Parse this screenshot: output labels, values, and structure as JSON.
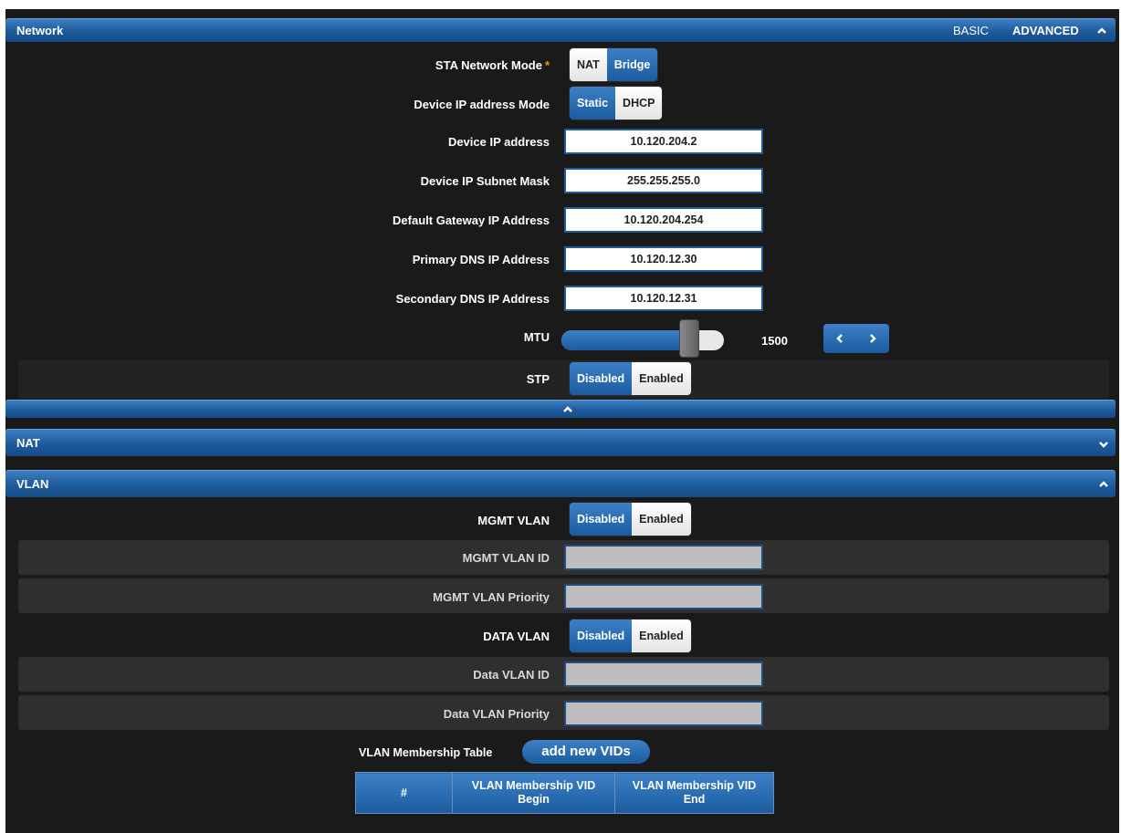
{
  "network": {
    "title": "Network",
    "mode_basic": "BASIC",
    "mode_advanced": "ADVANCED",
    "sta_mode": {
      "label": "STA Network Mode",
      "required": "*",
      "options": [
        "NAT",
        "Bridge"
      ],
      "selected": "Bridge"
    },
    "ip_mode": {
      "label": "Device IP address Mode",
      "options": [
        "Static",
        "DHCP"
      ],
      "selected": "Static"
    },
    "ip_address": {
      "label": "Device IP address",
      "value": "10.120.204.2"
    },
    "subnet": {
      "label": "Device IP Subnet Mask",
      "value": "255.255.255.0"
    },
    "gateway": {
      "label": "Default Gateway IP Address",
      "value": "10.120.204.254"
    },
    "dns1": {
      "label": "Primary DNS IP Address",
      "value": "10.120.12.30"
    },
    "dns2": {
      "label": "Secondary DNS IP Address",
      "value": "10.120.12.31"
    },
    "mtu": {
      "label": "MTU",
      "value": "1500",
      "fill_fraction": 0.8
    },
    "stp": {
      "label": "STP",
      "options": [
        "Disabled",
        "Enabled"
      ],
      "selected": "Disabled"
    }
  },
  "nat": {
    "title": "NAT"
  },
  "vlan": {
    "title": "VLAN",
    "mgmt_vlan": {
      "label": "MGMT VLAN",
      "options": [
        "Disabled",
        "Enabled"
      ],
      "selected": "Disabled"
    },
    "mgmt_vlan_id": {
      "label": "MGMT VLAN ID",
      "value": ""
    },
    "mgmt_vlan_priority": {
      "label": "MGMT VLAN Priority",
      "value": ""
    },
    "data_vlan": {
      "label": "DATA VLAN",
      "options": [
        "Disabled",
        "Enabled"
      ],
      "selected": "Disabled"
    },
    "data_vlan_id": {
      "label": "Data VLAN ID",
      "value": ""
    },
    "data_vlan_priority": {
      "label": "Data VLAN Priority",
      "value": ""
    },
    "membership_label": "VLAN Membership Table",
    "add_button": "add new VIDs",
    "table_headers": [
      "#",
      "VLAN Membership VID Begin",
      "VLAN Membership VID End"
    ]
  },
  "colors": {
    "accent": "#1d5a9c",
    "panel": "#1a1a1a",
    "required": "#e8a000"
  },
  "icons": {
    "collapse": "chevron-up-icon",
    "expand": "chevron-down-icon",
    "prev": "chevron-left-icon",
    "next": "chevron-right-icon"
  }
}
